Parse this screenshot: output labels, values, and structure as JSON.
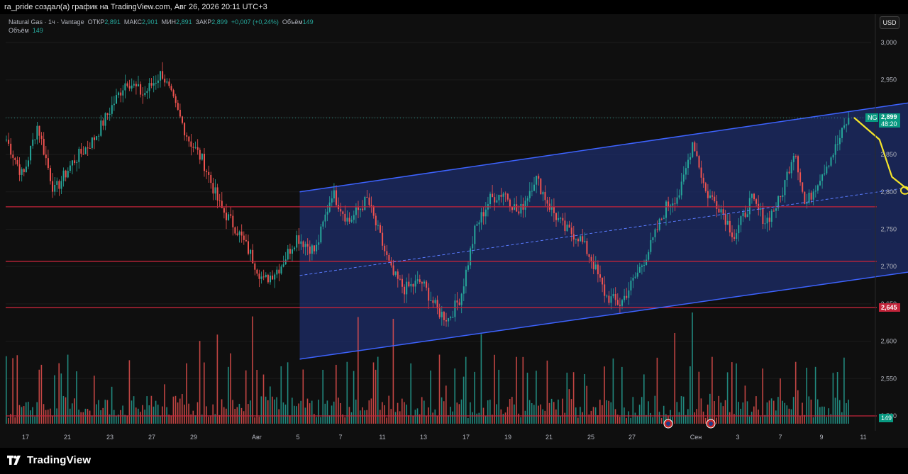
{
  "header": {
    "caption": "ra_pride создал(а) график на TradingView.com, Авг 26, 2026 20:11 UTC+3"
  },
  "legend": {
    "symbol": "Natural Gas · 1ч · Vantage",
    "open_label": "ОТКР",
    "open": "2,891",
    "high_label": "МАКС",
    "high": "2,901",
    "low_label": "МИН",
    "low": "2,891",
    "close_label": "ЗАКР",
    "close": "2,899",
    "change": "+0,007 (+0,24%)",
    "volume_label": "Объём",
    "volume": "149",
    "volume_line_label": "Объём",
    "volume_line_value": "149"
  },
  "currency_button": "USD",
  "price_tags": {
    "ticker": "NG",
    "last_price": "2,899",
    "countdown": "48:20",
    "level_2645": "2,645",
    "volume_value": "149"
  },
  "branding": {
    "name": "TradingView"
  },
  "colors": {
    "background": "#0f0f0f",
    "bull": "#26a69a",
    "bear": "#ef5350",
    "channel_line": "#3d63ff",
    "channel_fill": "#1e2d6b",
    "level_line": "#c2243a",
    "projection": "#f5e52a"
  },
  "chart_data": {
    "type": "candlestick",
    "timeframe": "1h",
    "currency": "USD",
    "ylim": [
      2.48,
      3.03
    ],
    "y_ticks": [
      "3,000",
      "2,950",
      "2,900",
      "2,850",
      "2,800",
      "2,750",
      "2,700",
      "2,650",
      "2,600",
      "2,550",
      "2,500"
    ],
    "x_ticks": [
      "17",
      "21",
      "23",
      "27",
      "29",
      "Авг",
      "5",
      "7",
      "11",
      "13",
      "17",
      "19",
      "21",
      "25",
      "27",
      "Сен",
      "3",
      "7",
      "9",
      "11"
    ],
    "price_path": [
      [
        0,
        2.87
      ],
      [
        0.8,
        2.82
      ],
      [
        1.5,
        2.89
      ],
      [
        2.3,
        2.8
      ],
      [
        3.2,
        2.84
      ],
      [
        4.2,
        2.87
      ],
      [
        5.0,
        2.91
      ],
      [
        5.8,
        2.95
      ],
      [
        6.6,
        2.93
      ],
      [
        7.5,
        2.96
      ],
      [
        8.2,
        2.91
      ],
      [
        8.8,
        2.87
      ],
      [
        9.5,
        2.84
      ],
      [
        10.3,
        2.78
      ],
      [
        11.1,
        2.75
      ],
      [
        11.7,
        2.72
      ],
      [
        12.4,
        2.68
      ],
      [
        13.2,
        2.7
      ],
      [
        14.0,
        2.74
      ],
      [
        14.9,
        2.72
      ],
      [
        15.7,
        2.8
      ],
      [
        16.5,
        2.76
      ],
      [
        17.4,
        2.79
      ],
      [
        18.0,
        2.74
      ],
      [
        18.6,
        2.69
      ],
      [
        19.2,
        2.67
      ],
      [
        20.0,
        2.68
      ],
      [
        20.8,
        2.64
      ],
      [
        21.3,
        2.63
      ],
      [
        21.9,
        2.66
      ],
      [
        22.6,
        2.75
      ],
      [
        23.3,
        2.79
      ],
      [
        24.0,
        2.8
      ],
      [
        24.7,
        2.77
      ],
      [
        25.5,
        2.82
      ],
      [
        26.2,
        2.78
      ],
      [
        26.9,
        2.75
      ],
      [
        27.6,
        2.74
      ],
      [
        28.2,
        2.71
      ],
      [
        28.9,
        2.66
      ],
      [
        29.6,
        2.65
      ],
      [
        30.4,
        2.69
      ],
      [
        31.1,
        2.73
      ],
      [
        31.8,
        2.78
      ],
      [
        32.5,
        2.8
      ],
      [
        33.1,
        2.87
      ],
      [
        33.7,
        2.8
      ],
      [
        34.4,
        2.78
      ],
      [
        35.1,
        2.74
      ],
      [
        35.9,
        2.79
      ],
      [
        36.6,
        2.76
      ],
      [
        37.3,
        2.79
      ],
      [
        38.0,
        2.86
      ],
      [
        38.5,
        2.78
      ],
      [
        39.2,
        2.82
      ],
      [
        40.0,
        2.86
      ],
      [
        40.6,
        2.9
      ]
    ],
    "last_price": 2.899,
    "horizontal_levels": [
      2.78,
      2.707,
      2.645,
      2.5
    ],
    "channel": {
      "upper": [
        [
          14.2,
          2.8
        ],
        [
          49.0,
          2.942
        ]
      ],
      "lower": [
        [
          14.2,
          2.576
        ],
        [
          49.0,
          2.715
        ]
      ]
    },
    "projection_path": [
      [
        40.8,
        2.899
      ],
      [
        42.0,
        2.87
      ],
      [
        42.6,
        2.82
      ],
      [
        43.5,
        2.8
      ],
      [
        44.5,
        2.77
      ],
      [
        45.5,
        2.72
      ],
      [
        46.2,
        2.72
      ],
      [
        47.0,
        2.76
      ],
      [
        48.0,
        2.79
      ],
      [
        49.0,
        2.82
      ],
      [
        50.8,
        2.843
      ]
    ],
    "event_markers": [
      41.0,
      43.6
    ]
  }
}
